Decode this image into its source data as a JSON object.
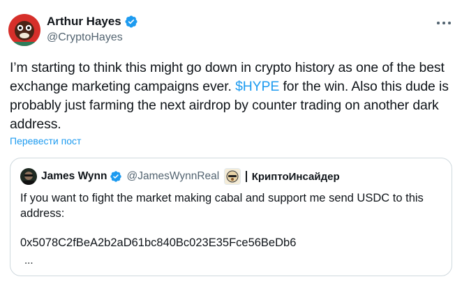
{
  "author": {
    "name": "Arthur Hayes",
    "handle": "@CryptoHayes",
    "verified": true
  },
  "tweet": {
    "text_before": "I’m starting to think this might go down in crypto history as one of the best exchange marketing campaigns ever. ",
    "cashtag": "$HYPE",
    "text_after": " for the win. Also this dude is probably just farming the next airdrop by counter trading on another dark address.",
    "translate_label": "Перевести пост"
  },
  "quote": {
    "name": "James Wynn",
    "handle": "@JamesWynnReal",
    "verified": true,
    "affiliation": "КриптоИнсайдер",
    "text": "If you want to fight the market making cabal and support me send USDC to this address:",
    "address": "0x5078C2fBeA2b2aD61bc840Bc023E35Fce56BeDb6",
    "truncated_indicator": "..."
  },
  "colors": {
    "link": "#1d9bf0",
    "verified_badge": "#1d9bf0",
    "secondary_text": "#536471",
    "border": "#cfd9de"
  }
}
